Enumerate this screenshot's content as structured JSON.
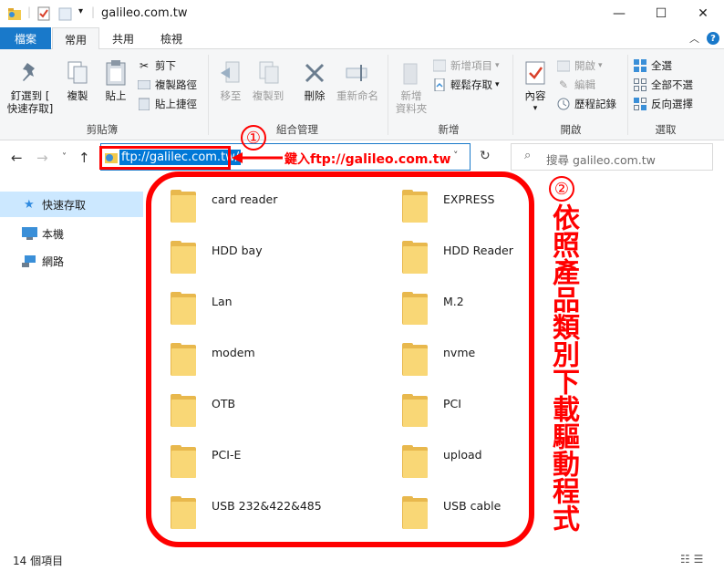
{
  "window": {
    "title": "galileo.com.tw",
    "minimize": "—",
    "maximize": "☐",
    "close": "✕"
  },
  "ribbon_tabs": {
    "file": "檔案",
    "home": "常用",
    "share": "共用",
    "view": "檢視"
  },
  "ribbon": {
    "clipboard": {
      "pin": "釘選到 [\n快速存取]",
      "copy": "複製",
      "paste": "貼上",
      "cut": "剪下",
      "copy_path": "複製路徑",
      "paste_shortcut": "貼上捷徑",
      "label": "剪貼簿"
    },
    "organize": {
      "move_to": "移至",
      "copy_to": "複製到",
      "delete": "刪除",
      "rename": "重新命名",
      "label": "組合管理"
    },
    "new": {
      "new_folder": "新增\n資料夾",
      "new_item": "新增項目",
      "easy_access": "輕鬆存取",
      "label": "新增"
    },
    "open": {
      "properties": "內容",
      "open": "開啟",
      "edit": "編輯",
      "history": "歷程記錄",
      "label": "開啟"
    },
    "select": {
      "select_all": "全選",
      "select_none": "全部不選",
      "invert": "反向選擇",
      "label": "選取"
    }
  },
  "address": {
    "value": "ftp://galilec.com.tw/",
    "search_placeholder": "搜尋 galileo.com.tw"
  },
  "nav_pane": {
    "items": [
      "快速存取",
      "本機",
      "網路"
    ]
  },
  "folders": [
    "card reader",
    "EXPRESS",
    "HDD bay",
    "HDD Reader",
    "Lan",
    "M.2",
    "modem",
    "nvme",
    "OTB",
    "PCI",
    "PCI-E",
    "upload",
    "USB 232&422&485",
    "USB cable"
  ],
  "annotations": {
    "step1": "①",
    "step1_text": "鍵入ftp://galileo.com.tw",
    "step2": "②",
    "step2_text": "依照產品類別下載驅動程式"
  },
  "status": {
    "count": "14 個項目"
  },
  "colors": {
    "accent": "#1979ca",
    "annotation_red": "#ff0000",
    "folder": "#f9d776"
  }
}
